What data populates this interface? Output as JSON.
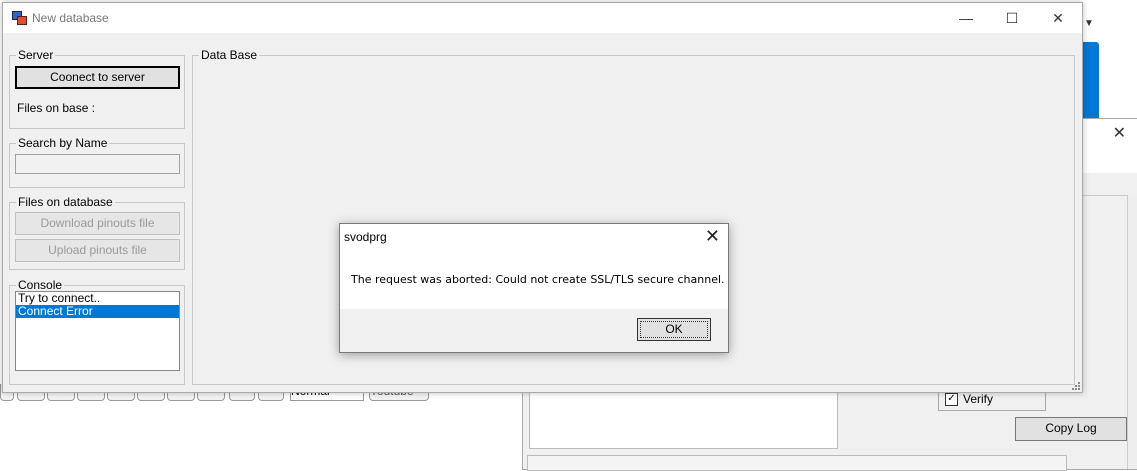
{
  "window": {
    "title": "New database",
    "minimize_icon": "minimize-icon",
    "maximize_icon": "maximize-icon",
    "close_icon": "close-icon"
  },
  "server_group": {
    "legend": "Server",
    "connect_button": "Coonect to server",
    "files_on_base_label": "Files on base :"
  },
  "search_group": {
    "legend": "Search by Name",
    "value": ""
  },
  "files_group": {
    "legend": "Files on database",
    "download_button": "Download pinouts file",
    "upload_button": "Upload pinouts file"
  },
  "console_group": {
    "legend": "Console",
    "items": [
      "Try to connect..",
      "Connect Error"
    ],
    "selected_index": 1
  },
  "database_group": {
    "legend": "Data Base"
  },
  "dialog": {
    "title": "svodprg",
    "message": "The request was aborted: Could not create SSL/TLS secure channel.",
    "ok_button": "OK"
  },
  "background": {
    "verify_label": "Verify",
    "verify_checked": true,
    "copy_log_button": "Copy Log",
    "format_select": "Normal",
    "youtube_button": "Youtube"
  },
  "colors": {
    "selection": "#0078d7",
    "accent_blue": "#0078d7",
    "window_bg": "#f0f0f0"
  }
}
